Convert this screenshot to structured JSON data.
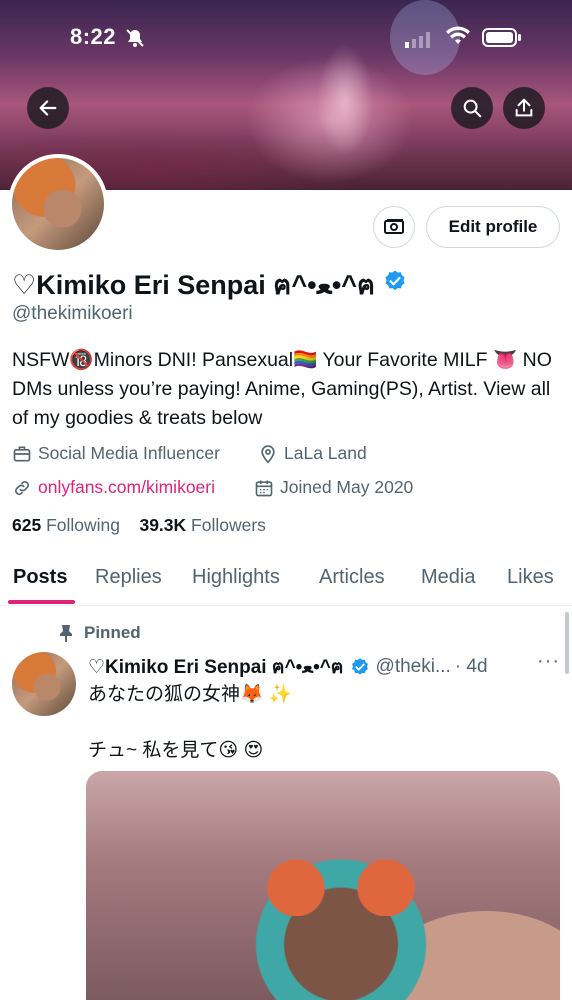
{
  "status_bar": {
    "time": "8:22"
  },
  "profile": {
    "name": "♡Kimiko Eri Senpai ᓚᘏᗢ",
    "name_display": "♡Kimiko Eri Senpai ฅ^•ﻌ•^ฅ",
    "handle": "@thekimikoeri",
    "edit_label": "Edit profile",
    "bio": "NSFW🔞Minors DNI! Pansexual🏳️‍🌈 Your Favorite MILF 👅 NO DMs unless you’re paying! Anime, Gaming(PS), Artist. View all of my goodies & treats below",
    "category": "Social Media Influencer",
    "location": "LaLa Land",
    "link": "onlyfans.com/kimikoeri",
    "joined": "Joined May 2020",
    "following_count": "625",
    "following_label": "Following",
    "followers_count": "39.3K",
    "followers_label": "Followers"
  },
  "tabs": [
    "Posts",
    "Replies",
    "Highlights",
    "Articles",
    "Media",
    "Likes"
  ],
  "pinned_post": {
    "pinned_label": "Pinned",
    "author": "♡Kimiko Eri Senpai ฅ^•ﻌ•^ฅ",
    "handle": "@theki...",
    "time": "· 4d",
    "more": "···",
    "line1": "あなたの狐の女神🦊 ✨",
    "line2": "チュ~ 私を見て😘 😍"
  },
  "colors": {
    "accent": "#e0237a",
    "verified": "#1d9bf0",
    "muted": "#536471"
  }
}
